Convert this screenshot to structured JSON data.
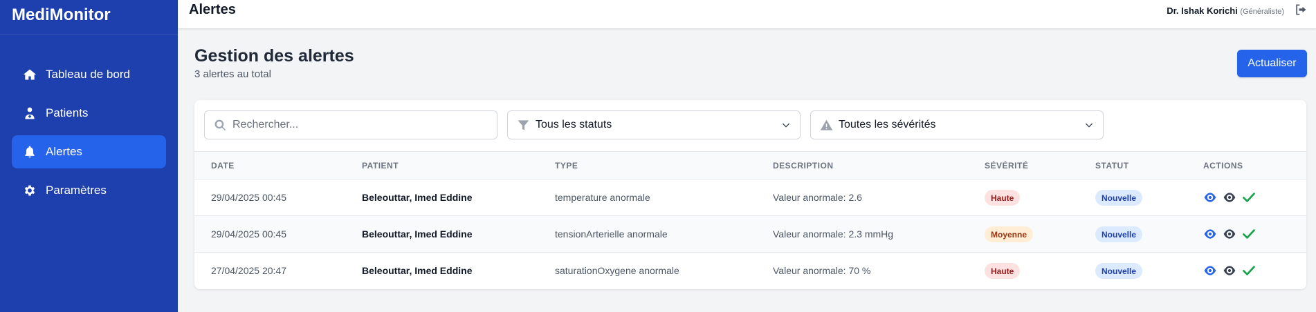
{
  "app": {
    "brand": "MediMonitor"
  },
  "sidebar": {
    "items": [
      {
        "label": "Tableau de bord",
        "icon": "home-icon",
        "active": false
      },
      {
        "label": "Patients",
        "icon": "user-doctor-icon",
        "active": false
      },
      {
        "label": "Alertes",
        "icon": "bell-icon",
        "active": true
      },
      {
        "label": "Paramètres",
        "icon": "gear-icon",
        "active": false
      }
    ]
  },
  "topbar": {
    "title": "Alertes",
    "user_name": "Dr. Ishak Korichi",
    "user_role": "(Généraliste)",
    "logout_icon": "logout-icon"
  },
  "page": {
    "title": "Gestion des alertes",
    "subtitle": "3 alertes au total",
    "refresh_label": "Actualiser"
  },
  "filters": {
    "search_placeholder": "Rechercher...",
    "status_value": "Tous les statuts",
    "severity_value": "Toutes les sévérités"
  },
  "table": {
    "headers": [
      "Date",
      "Patient",
      "Type",
      "Description",
      "Sévérité",
      "Statut",
      "Actions"
    ],
    "rows": [
      {
        "date": "29/04/2025 00:45",
        "patient": "Beleouttar, Imed Eddine",
        "type": "temperature anormale",
        "description": "Valeur anormale: 2.6",
        "severity": "Haute",
        "status": "Nouvelle"
      },
      {
        "date": "29/04/2025 00:45",
        "patient": "Beleouttar, Imed Eddine",
        "type": "tensionArterielle anormale",
        "description": "Valeur anormale: 2.3 mmHg",
        "severity": "Moyenne",
        "status": "Nouvelle"
      },
      {
        "date": "27/04/2025 20:47",
        "patient": "Beleouttar, Imed Eddine",
        "type": "saturationOxygene anormale",
        "description": "Valeur anormale: 70 %",
        "severity": "Haute",
        "status": "Nouvelle"
      }
    ]
  },
  "colors": {
    "sidebar_bg": "#1e3fae",
    "accent": "#2563eb",
    "severity_high": "#fee2e2",
    "severity_medium": "#ffedd5",
    "status_new": "#dbeafe",
    "action_view": "#2563eb",
    "action_mark_read": "#374151",
    "action_resolve": "#16a34a"
  }
}
